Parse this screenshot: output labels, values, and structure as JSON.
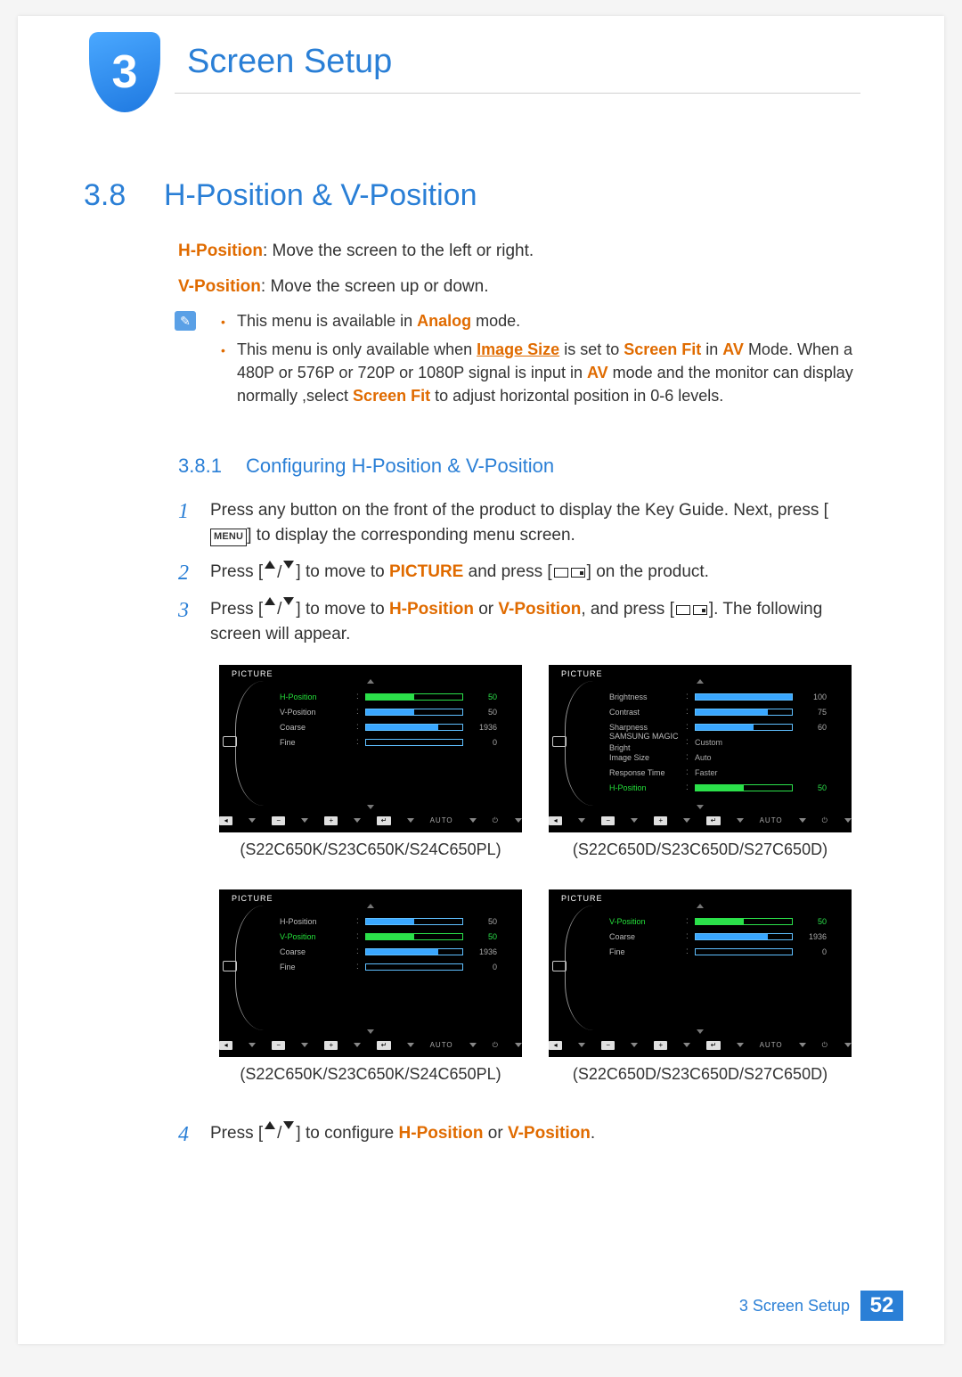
{
  "chapter": {
    "number": "3",
    "title": "Screen Setup"
  },
  "section": {
    "number": "3.8",
    "title": "H-Position & V-Position"
  },
  "intro": {
    "hpos_label": "H-Position",
    "hpos_desc": ": Move the screen to the left or right.",
    "vpos_label": "V-Position",
    "vpos_desc": ": Move the screen up or down."
  },
  "notes": {
    "n1_a": "This menu is available in ",
    "n1_analog": "Analog",
    "n1_b": "  mode.",
    "n2_a": "This menu is only available when ",
    "n2_image_size": "Image Size",
    "n2_b": " is set to ",
    "n2_screen_fit": "Screen Fit",
    "n2_c": " in ",
    "n2_av": "AV",
    "n2_d": " Mode. When a 480P or 576P or 720P or 1080P signal is input in ",
    "n2_av2": "AV",
    "n2_e": " mode and the monitor can display normally ,select ",
    "n2_screen_fit2": "Screen Fit",
    "n2_f": "  to adjust horizontal position in 0-6 levels."
  },
  "subsection": {
    "number": "3.8.1",
    "title": "Configuring H-Position & V-Position"
  },
  "steps": {
    "s1_a": "Press any button on the front of the product to display the Key Guide. Next, press [",
    "s1_menu": "MENU",
    "s1_b": "] to display the corresponding menu screen.",
    "s2_a": "Press [",
    "s2_b": "] to move to ",
    "s2_picture": "PICTURE",
    "s2_c": " and press [",
    "s2_d": "] on the product.",
    "s3_a": "Press [",
    "s3_b": "] to move to ",
    "s3_hpos": "H-Position",
    "s3_or": " or ",
    "s3_vpos": "V-Position",
    "s3_c": ", and press [",
    "s3_d": "]. The following screen will appear.",
    "s4_a": "Press [",
    "s4_b": "] to configure ",
    "s4_hpos": "H-Position",
    "s4_or": " or ",
    "s4_vpos": "V-Position",
    "s4_c": "."
  },
  "osd": {
    "title": "PICTURE",
    "auto_label": "AUTO",
    "panel1": {
      "rows": [
        {
          "label": "H-Position",
          "value": "50",
          "fill": 50,
          "selected": true
        },
        {
          "label": "V-Position",
          "value": "50",
          "fill": 50
        },
        {
          "label": "Coarse",
          "value": "1936",
          "fill": 75
        },
        {
          "label": "Fine",
          "value": "0",
          "fill": 0
        }
      ]
    },
    "panel2": {
      "rows": [
        {
          "label": "Brightness",
          "value": "100",
          "fill": 100
        },
        {
          "label": "Contrast",
          "value": "75",
          "fill": 75
        },
        {
          "label": "Sharpness",
          "value": "60",
          "fill": 60
        },
        {
          "label": "SAMSUNG MAGIC Bright",
          "text": "Custom"
        },
        {
          "label": "Image Size",
          "text": "Auto"
        },
        {
          "label": "Response Time",
          "text": "Faster"
        },
        {
          "label": "H-Position",
          "value": "50",
          "fill": 50,
          "selected": true
        }
      ]
    },
    "panel3": {
      "rows": [
        {
          "label": "H-Position",
          "value": "50",
          "fill": 50
        },
        {
          "label": "V-Position",
          "value": "50",
          "fill": 50,
          "selected": true
        },
        {
          "label": "Coarse",
          "value": "1936",
          "fill": 75
        },
        {
          "label": "Fine",
          "value": "0",
          "fill": 0
        }
      ]
    },
    "panel4": {
      "rows": [
        {
          "label": "V-Position",
          "value": "50",
          "fill": 50,
          "selected": true
        },
        {
          "label": "Coarse",
          "value": "1936",
          "fill": 75
        },
        {
          "label": "Fine",
          "value": "0",
          "fill": 0
        }
      ]
    }
  },
  "captions": {
    "left": "(S22C650K/S23C650K/S24C650PL)",
    "right": "(S22C650D/S23C650D/S27C650D)"
  },
  "footer": {
    "chapter_ref": "3 Screen Setup",
    "page": "52"
  }
}
